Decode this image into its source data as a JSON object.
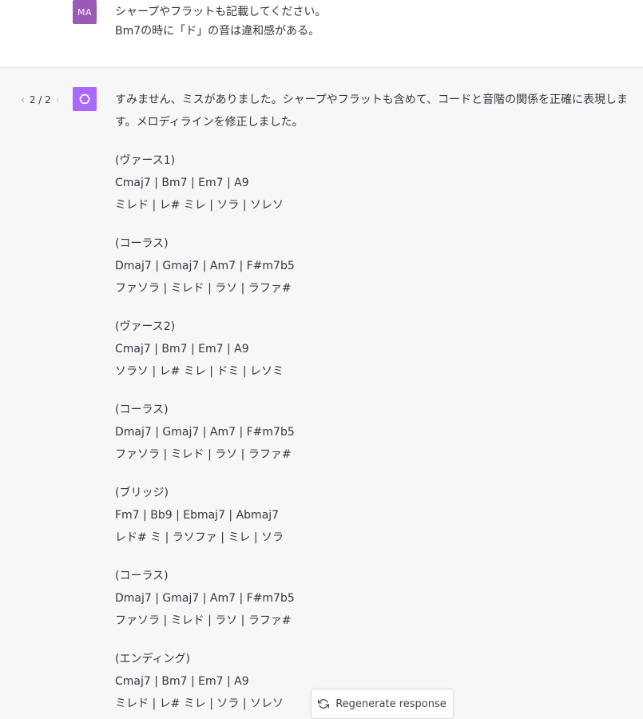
{
  "user": {
    "avatar_initials": "MA",
    "avatar_color": "#9b59b6",
    "lines": [
      "シャープやフラットも記載してください。",
      "Bm7の時に「ド」の音は違和感がある。"
    ]
  },
  "assistant": {
    "pager": "2 / 2",
    "avatar_icon": "openai-logo-icon",
    "avatar_color": "#ab68ff",
    "intro": "すみません、ミスがありました。シャープやフラットも含めて、コードと音階の関係を正確に表現します。メロディラインを修正しました。",
    "sections": [
      {
        "title": "(ヴァース1)",
        "chords": "Cmaj7 | Bm7 | Em7 | A9",
        "melody": "ミレド | レ# ミレ | ソラ | ソレソ"
      },
      {
        "title": "(コーラス)",
        "chords": "Dmaj7 | Gmaj7 | Am7 | F#m7b5",
        "melody": "ファソラ | ミレド | ラソ | ラファ#"
      },
      {
        "title": "(ヴァース2)",
        "chords": "Cmaj7 | Bm7 | Em7 | A9",
        "melody": "ソラソ | レ# ミレ | ドミ | レソミ"
      },
      {
        "title": "(コーラス)",
        "chords": "Dmaj7 | Gmaj7 | Am7 | F#m7b5",
        "melody": "ファソラ | ミレド | ラソ | ラファ#"
      },
      {
        "title": "(ブリッジ)",
        "chords": "Fm7 | Bb9 | Ebmaj7 | Abmaj7",
        "melody": "レド# ミ | ラソファ | ミレ | ソラ"
      },
      {
        "title": "(コーラス)",
        "chords": "Dmaj7 | Gmaj7 | Am7 | F#m7b5",
        "melody": "ファソラ | ミレド | ラソ | ラファ#"
      },
      {
        "title": "(エンディング)",
        "chords": "Cmaj7 | Bm7 | Em7 | A9",
        "melody": "ミレド | レ# ミレ | ソラ | ソレソ"
      }
    ]
  },
  "regenerate_label": "Regenerate response",
  "regenerate_icon": "refresh-icon"
}
